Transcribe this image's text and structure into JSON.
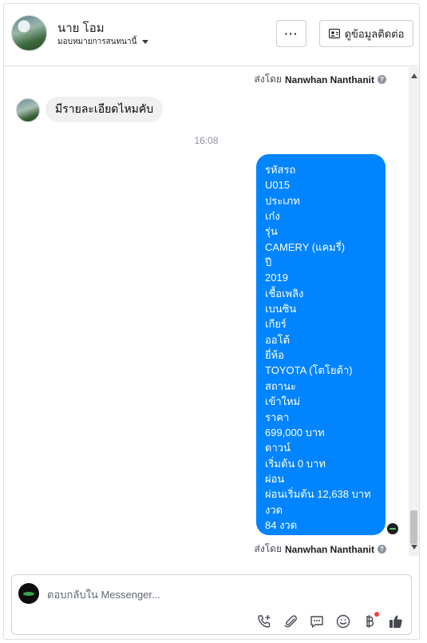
{
  "header": {
    "contact_name": "นาย โอม",
    "assigned_to": "มอบหมายการสนทนานี้",
    "more_label": "···",
    "view_contact_label": "ดูข้อมูลติดต่อ"
  },
  "conversation": {
    "sent_by_prefix": "ส่งโดย",
    "sent_by_name": "Nanwhan Nanthanit",
    "incoming_message": "มีรายละเอียดไหมคับ",
    "timestamp": "16:08",
    "outgoing_lines": [
      "รหัสรถ",
      "U015",
      "ประเภท",
      "เก๋ง",
      "รุ่น",
      "CAMERY (แคมรี่)",
      "ปี",
      "2019",
      "เชื้อเพลิง",
      "เบนซิน",
      "เกียร์",
      "ออโต้",
      "ยี่ห้อ",
      "TOYOTA (โตโยต้า)",
      "สถานะ",
      "เข้าใหม่",
      "ราคา",
      "699,000 บาท",
      "ดาวน์",
      "เริ่มต้น 0 บาท",
      "ผ่อน",
      "ผ่อนเริ่มต้น 12,638 บาท",
      "งวด",
      "84 งวด"
    ]
  },
  "composer": {
    "placeholder": "ตอบกลับใน Messenger...",
    "tools": [
      "call-add-icon",
      "attachment-icon",
      "saved-reply-icon",
      "emoji-icon",
      "payment-icon",
      "like-icon"
    ]
  },
  "colors": {
    "accent": "#0084ff",
    "incoming_bubble": "#f0f0f0",
    "notification": "#fa3e3e"
  }
}
